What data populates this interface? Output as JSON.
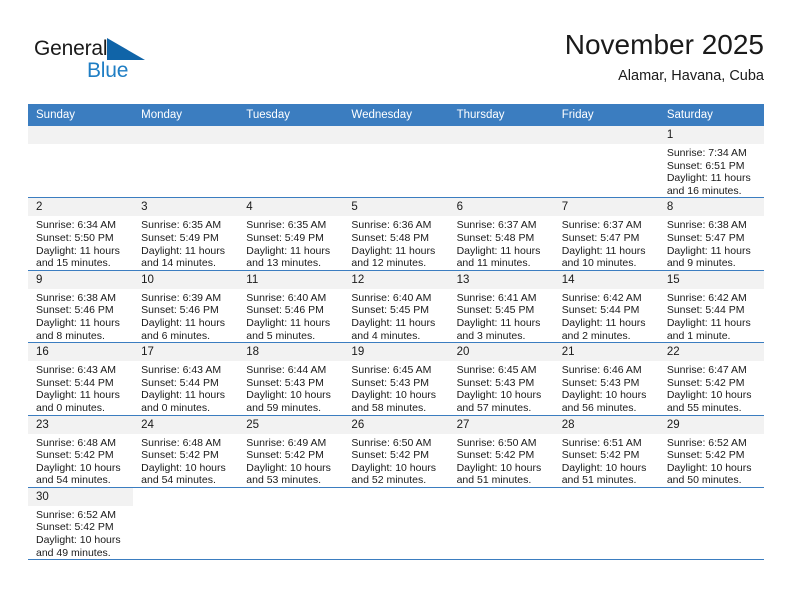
{
  "brand": {
    "name_part1": "General",
    "name_part2": "Blue",
    "accent_color": "#1f7ec4"
  },
  "header": {
    "title": "November 2025",
    "subtitle": "Alamar, Havana, Cuba"
  },
  "calendar": {
    "header_color": "#3b7dc0",
    "weekday_headers": [
      "Sunday",
      "Monday",
      "Tuesday",
      "Wednesday",
      "Thursday",
      "Friday",
      "Saturday"
    ],
    "weeks": [
      [
        {
          "day": "",
          "blank": true,
          "type": "blank"
        },
        {
          "day": "",
          "blank": true,
          "type": "blank"
        },
        {
          "day": "",
          "blank": true,
          "type": "blank"
        },
        {
          "day": "",
          "blank": true,
          "type": "blank"
        },
        {
          "day": "",
          "blank": true,
          "type": "blank"
        },
        {
          "day": "",
          "blank": true,
          "type": "blank"
        },
        {
          "day": "1",
          "sunrise": "Sunrise: 7:34 AM",
          "sunset": "Sunset: 6:51 PM",
          "daylight1": "Daylight: 11 hours",
          "daylight2": "and 16 minutes."
        }
      ],
      [
        {
          "day": "2",
          "sunrise": "Sunrise: 6:34 AM",
          "sunset": "Sunset: 5:50 PM",
          "daylight1": "Daylight: 11 hours",
          "daylight2": "and 15 minutes."
        },
        {
          "day": "3",
          "sunrise": "Sunrise: 6:35 AM",
          "sunset": "Sunset: 5:49 PM",
          "daylight1": "Daylight: 11 hours",
          "daylight2": "and 14 minutes."
        },
        {
          "day": "4",
          "sunrise": "Sunrise: 6:35 AM",
          "sunset": "Sunset: 5:49 PM",
          "daylight1": "Daylight: 11 hours",
          "daylight2": "and 13 minutes."
        },
        {
          "day": "5",
          "sunrise": "Sunrise: 6:36 AM",
          "sunset": "Sunset: 5:48 PM",
          "daylight1": "Daylight: 11 hours",
          "daylight2": "and 12 minutes."
        },
        {
          "day": "6",
          "sunrise": "Sunrise: 6:37 AM",
          "sunset": "Sunset: 5:48 PM",
          "daylight1": "Daylight: 11 hours",
          "daylight2": "and 11 minutes."
        },
        {
          "day": "7",
          "sunrise": "Sunrise: 6:37 AM",
          "sunset": "Sunset: 5:47 PM",
          "daylight1": "Daylight: 11 hours",
          "daylight2": "and 10 minutes."
        },
        {
          "day": "8",
          "sunrise": "Sunrise: 6:38 AM",
          "sunset": "Sunset: 5:47 PM",
          "daylight1": "Daylight: 11 hours",
          "daylight2": "and 9 minutes."
        }
      ],
      [
        {
          "day": "9",
          "sunrise": "Sunrise: 6:38 AM",
          "sunset": "Sunset: 5:46 PM",
          "daylight1": "Daylight: 11 hours",
          "daylight2": "and 8 minutes."
        },
        {
          "day": "10",
          "sunrise": "Sunrise: 6:39 AM",
          "sunset": "Sunset: 5:46 PM",
          "daylight1": "Daylight: 11 hours",
          "daylight2": "and 6 minutes."
        },
        {
          "day": "11",
          "sunrise": "Sunrise: 6:40 AM",
          "sunset": "Sunset: 5:46 PM",
          "daylight1": "Daylight: 11 hours",
          "daylight2": "and 5 minutes."
        },
        {
          "day": "12",
          "sunrise": "Sunrise: 6:40 AM",
          "sunset": "Sunset: 5:45 PM",
          "daylight1": "Daylight: 11 hours",
          "daylight2": "and 4 minutes."
        },
        {
          "day": "13",
          "sunrise": "Sunrise: 6:41 AM",
          "sunset": "Sunset: 5:45 PM",
          "daylight1": "Daylight: 11 hours",
          "daylight2": "and 3 minutes."
        },
        {
          "day": "14",
          "sunrise": "Sunrise: 6:42 AM",
          "sunset": "Sunset: 5:44 PM",
          "daylight1": "Daylight: 11 hours",
          "daylight2": "and 2 minutes."
        },
        {
          "day": "15",
          "sunrise": "Sunrise: 6:42 AM",
          "sunset": "Sunset: 5:44 PM",
          "daylight1": "Daylight: 11 hours",
          "daylight2": "and 1 minute."
        }
      ],
      [
        {
          "day": "16",
          "sunrise": "Sunrise: 6:43 AM",
          "sunset": "Sunset: 5:44 PM",
          "daylight1": "Daylight: 11 hours",
          "daylight2": "and 0 minutes."
        },
        {
          "day": "17",
          "sunrise": "Sunrise: 6:43 AM",
          "sunset": "Sunset: 5:44 PM",
          "daylight1": "Daylight: 11 hours",
          "daylight2": "and 0 minutes."
        },
        {
          "day": "18",
          "sunrise": "Sunrise: 6:44 AM",
          "sunset": "Sunset: 5:43 PM",
          "daylight1": "Daylight: 10 hours",
          "daylight2": "and 59 minutes."
        },
        {
          "day": "19",
          "sunrise": "Sunrise: 6:45 AM",
          "sunset": "Sunset: 5:43 PM",
          "daylight1": "Daylight: 10 hours",
          "daylight2": "and 58 minutes."
        },
        {
          "day": "20",
          "sunrise": "Sunrise: 6:45 AM",
          "sunset": "Sunset: 5:43 PM",
          "daylight1": "Daylight: 10 hours",
          "daylight2": "and 57 minutes."
        },
        {
          "day": "21",
          "sunrise": "Sunrise: 6:46 AM",
          "sunset": "Sunset: 5:43 PM",
          "daylight1": "Daylight: 10 hours",
          "daylight2": "and 56 minutes."
        },
        {
          "day": "22",
          "sunrise": "Sunrise: 6:47 AM",
          "sunset": "Sunset: 5:42 PM",
          "daylight1": "Daylight: 10 hours",
          "daylight2": "and 55 minutes."
        }
      ],
      [
        {
          "day": "23",
          "sunrise": "Sunrise: 6:48 AM",
          "sunset": "Sunset: 5:42 PM",
          "daylight1": "Daylight: 10 hours",
          "daylight2": "and 54 minutes."
        },
        {
          "day": "24",
          "sunrise": "Sunrise: 6:48 AM",
          "sunset": "Sunset: 5:42 PM",
          "daylight1": "Daylight: 10 hours",
          "daylight2": "and 54 minutes."
        },
        {
          "day": "25",
          "sunrise": "Sunrise: 6:49 AM",
          "sunset": "Sunset: 5:42 PM",
          "daylight1": "Daylight: 10 hours",
          "daylight2": "and 53 minutes."
        },
        {
          "day": "26",
          "sunrise": "Sunrise: 6:50 AM",
          "sunset": "Sunset: 5:42 PM",
          "daylight1": "Daylight: 10 hours",
          "daylight2": "and 52 minutes."
        },
        {
          "day": "27",
          "sunrise": "Sunrise: 6:50 AM",
          "sunset": "Sunset: 5:42 PM",
          "daylight1": "Daylight: 10 hours",
          "daylight2": "and 51 minutes."
        },
        {
          "day": "28",
          "sunrise": "Sunrise: 6:51 AM",
          "sunset": "Sunset: 5:42 PM",
          "daylight1": "Daylight: 10 hours",
          "daylight2": "and 51 minutes."
        },
        {
          "day": "29",
          "sunrise": "Sunrise: 6:52 AM",
          "sunset": "Sunset: 5:42 PM",
          "daylight1": "Daylight: 10 hours",
          "daylight2": "and 50 minutes."
        }
      ],
      [
        {
          "day": "30",
          "sunrise": "Sunrise: 6:52 AM",
          "sunset": "Sunset: 5:42 PM",
          "daylight1": "Daylight: 10 hours",
          "daylight2": "and 49 minutes."
        },
        {
          "day": "",
          "blank": true,
          "type": "void"
        },
        {
          "day": "",
          "blank": true,
          "type": "void"
        },
        {
          "day": "",
          "blank": true,
          "type": "void"
        },
        {
          "day": "",
          "blank": true,
          "type": "void"
        },
        {
          "day": "",
          "blank": true,
          "type": "void"
        },
        {
          "day": "",
          "blank": true,
          "type": "void"
        }
      ]
    ]
  }
}
